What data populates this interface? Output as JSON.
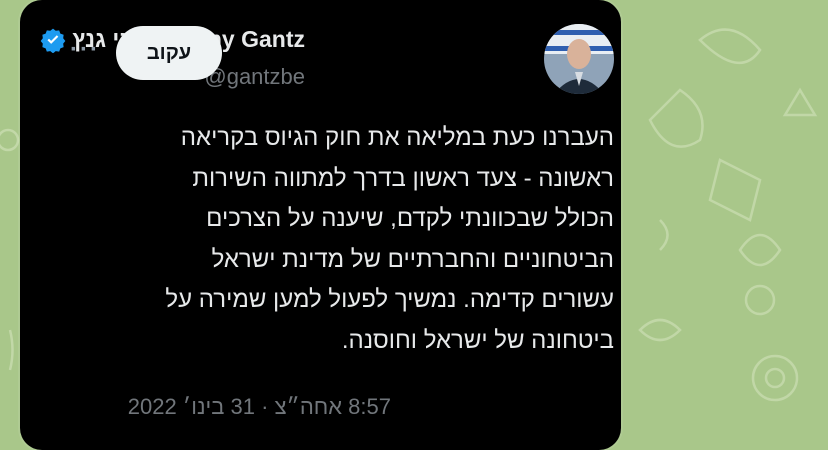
{
  "tweet": {
    "display_name": "בני גנץ - Benny Gantz",
    "handle": "@gantzbe",
    "follow_label": "עקוב",
    "more_icon": "more-dots-icon",
    "verified_icon": "verified-badge-icon",
    "text": "העברנו כעת במליאה את חוק הגיוס בקריאה\nראשונה - צעד ראשון בדרך למתווה השירות\nהכולל שבכוונתי לקדם, שיענה על הצרכים\nהביטחוניים והחברתיים של מדינת ישראל\nעשורים קדימה. נמשיך לפעול למען שמירה על\nביטחונה של ישראל וחוסנה.",
    "timestamp": "8:57 אחה״צ · 31 בינו׳ 2022"
  },
  "colors": {
    "background": "#a9c78a",
    "card": "#000000",
    "text": "#e7e9ea",
    "muted": "#71767b",
    "verified": "#1d9bf0",
    "follow_bg": "#eff3f4"
  }
}
